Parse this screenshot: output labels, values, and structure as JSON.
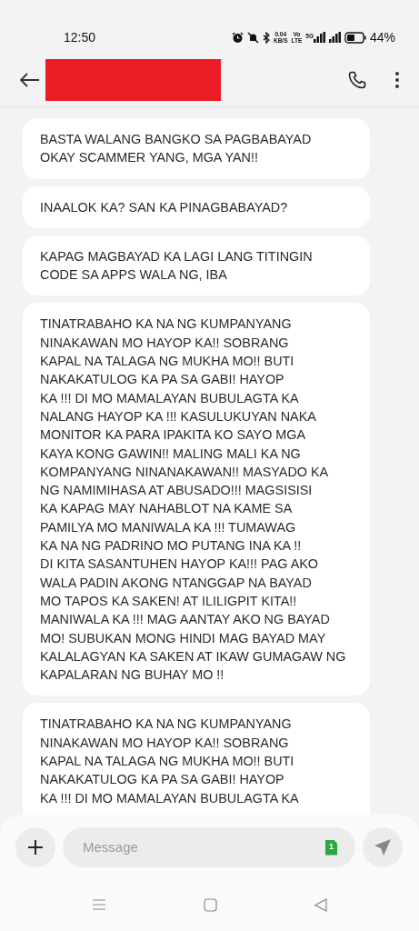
{
  "status_bar": {
    "time": "12:50",
    "speed": "0.04",
    "speed_unit": "KB/S",
    "volte_top": "Vo",
    "volte_bottom": "LTE",
    "network": "5G",
    "battery": "44%"
  },
  "header": {
    "contact_redacted": true
  },
  "messages": [
    {
      "text": "BASTA WALANG BANGKO SA PAGBABAYAD\nOKAY SCAMMER YANG, MGA YAN!!"
    },
    {
      "text": "INAALOK KA?  SAN KA PINAGBABAYAD?"
    },
    {
      "text": "KAPAG MAGBAYAD KA LAGI LANG TITINGIN\nCODE SA APPS WALA NG, IBA"
    },
    {
      "text": "TINATRABAHO KA NA NG KUMPANYANG\nNINAKAWAN MO HAYOP KA!! SOBRANG\nKAPAL NA TALAGA NG MUKHA MO!! BUTI\nNAKAKATULOG KA PA SA GABI! HAYOP\nKA !!! DI MO MAMALAYAN BUBULAGTA KA\nNALANG HAYOP KA !!! KASULUKUYAN NAKA\nMONITOR KA PARA IPAKITA KO SAYO MGA\nKAYA KONG GAWIN!! MALING MALI KA NG\nKOMPANYANG NINANAKAWAN!! MASYADO KA\nNG NAMIMIHASA AT ABUSADO!!! MAGSISISI\nKA KAPAG MAY NAHABLOT NA KAME SA\nPAMILYA MO MANIWALA KA !!! TUMAWAG\nKA NA NG PADRINO MO PUTANG INA KA !!\nDI KITA SASANTUHEN HAYOP KA!!! PAG AKO\nWALA PADIN AKONG NTANGGAP NA BAYAD\nMO TAPOS KA SAKEN! AT ILILIGPIT KITA!!\nMANIWALA KA !!! MAG AANTAY AKO NG BAYAD\nMO! SUBUKAN MONG HINDI MAG BAYAD MAY\nKALALAGYAN KA SAKEN AT IKAW GUMAGAW NG\nKAPALARAN NG BUHAY MO !!"
    },
    {
      "text": "TINATRABAHO KA NA NG KUMPANYANG\nNINAKAWAN MO HAYOP KA!! SOBRANG\nKAPAL NA TALAGA NG MUKHA MO!! BUTI\nNAKAKATULOG KA PA SA GABI! HAYOP\nKA !!! DI MO MAMALAYAN BUBULAGTA KA"
    }
  ],
  "composer": {
    "placeholder": "Message",
    "sim": "1"
  }
}
